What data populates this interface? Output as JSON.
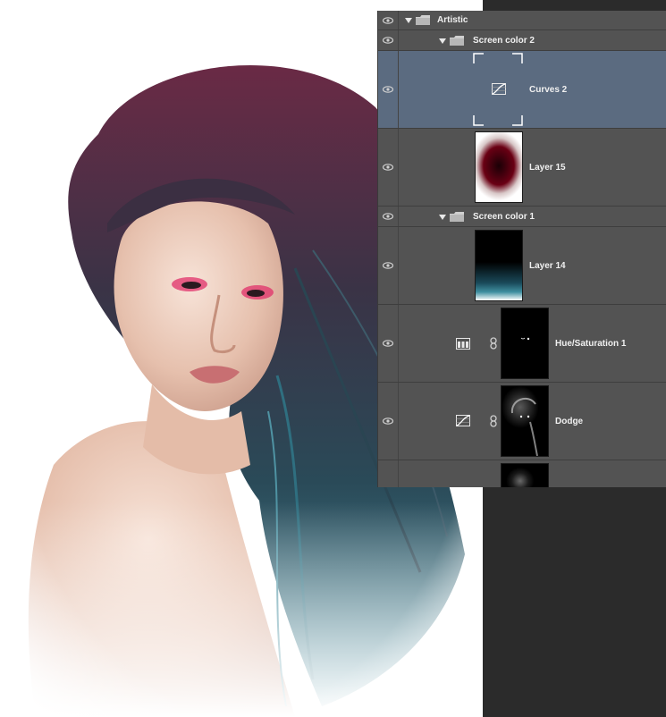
{
  "layers_panel": {
    "layers": [
      {
        "type": "group",
        "name": "Artistic",
        "visible": true,
        "icon": "folder-icon"
      },
      {
        "type": "group",
        "name": "Screen color 2",
        "visible": true,
        "icon": "folder-icon"
      },
      {
        "type": "adjustment",
        "name": "Curves 2",
        "visible": true,
        "selected": true,
        "icon": "curves-icon"
      },
      {
        "type": "pixel",
        "name": "Layer 15",
        "visible": true
      },
      {
        "type": "group",
        "name": "Screen color 1",
        "visible": true,
        "icon": "folder-icon"
      },
      {
        "type": "pixel",
        "name": "Layer 14",
        "visible": true
      },
      {
        "type": "adjustment",
        "name": "Hue/Saturation 1",
        "visible": true,
        "icon": "hue-saturation-icon",
        "has_mask": true
      },
      {
        "type": "adjustment",
        "name": "Dodge",
        "visible": true,
        "icon": "curves-icon",
        "has_mask": true
      }
    ]
  },
  "colors": {
    "panel_bg": "#535353",
    "selected_row": "#5b6b80",
    "hair_magenta": "#6a2a45",
    "hair_teal": "#2f6f80",
    "makeup_pink": "#e0306a"
  }
}
